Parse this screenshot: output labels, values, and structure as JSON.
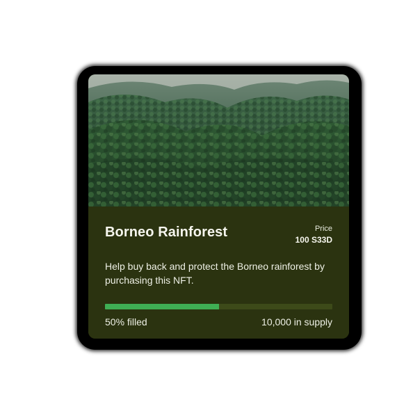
{
  "card": {
    "title": "Borneo Rainforest",
    "price_label": "Price",
    "price_value": "100 S33D",
    "description": "Help buy back and protect the Borneo rainforest by purchasing this NFT.",
    "progress_fraction": 0.5,
    "filled_text": "50% filled",
    "supply_text": "10,000 in supply",
    "image_subject": "aerial view of forested mountains"
  },
  "colors": {
    "card_background": "#2b3310",
    "progress_track": "#3d4a19",
    "progress_fill": "#3fae54",
    "text": "#eef0e5"
  }
}
